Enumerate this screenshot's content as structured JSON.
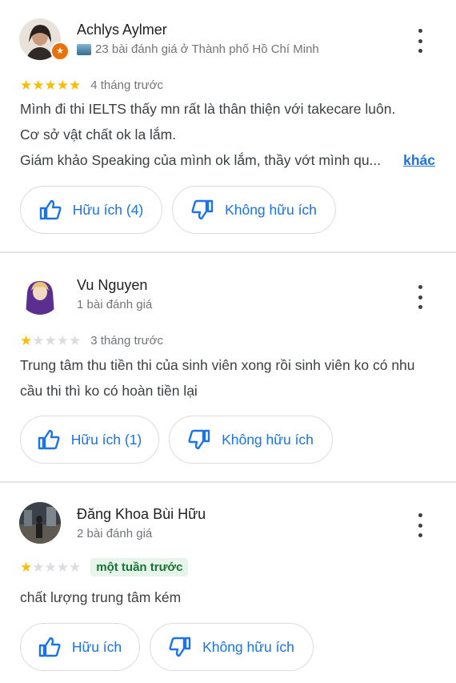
{
  "reviews": [
    {
      "name": "Achlys Aylmer",
      "meta": "23 bài đánh giá ở Thành phố Hồ Chí Minh",
      "local_guide": true,
      "rating": 5,
      "time": "4 tháng trước",
      "time_highlight": false,
      "lines": [
        "Mình đi thi IELTS thấy mn rất là thân thiện với takecare luôn.",
        "Cơ sở vật chất ok la lắm.",
        "Giám khảo Speaking của mình ok lắm, thầy vớt mình qu..."
      ],
      "more_label": "khác",
      "helpful_label": "Hữu ích (4)",
      "not_helpful_label": "Không hữu ích"
    },
    {
      "name": "Vu Nguyen",
      "meta": "1 bài đánh giá",
      "local_guide": false,
      "rating": 1,
      "time": "3 tháng trước",
      "time_highlight": false,
      "lines": [
        "Trung tâm thu tiền thi của sinh viên xong rồi sinh viên ko có nhu",
        "cầu thi thì ko có hoàn tiền lại"
      ],
      "helpful_label": "Hữu ích (1)",
      "not_helpful_label": "Không hữu ích"
    },
    {
      "name": "Đăng Khoa Bùi Hữu",
      "meta": "2 bài đánh giá",
      "local_guide": false,
      "rating": 1,
      "time": "một tuần trước",
      "time_highlight": true,
      "lines": [
        "chất lượng trung tâm kém"
      ],
      "helpful_label": "Hữu ích",
      "not_helpful_label": "Không hữu ích"
    }
  ],
  "colors": {
    "accent": "#1a73e8",
    "star_on": "#fbbc04",
    "star_off": "#dadce0",
    "highlight_bg": "#e6f4ea",
    "highlight_text": "#137333",
    "local_guide_badge": "#e8710a"
  }
}
